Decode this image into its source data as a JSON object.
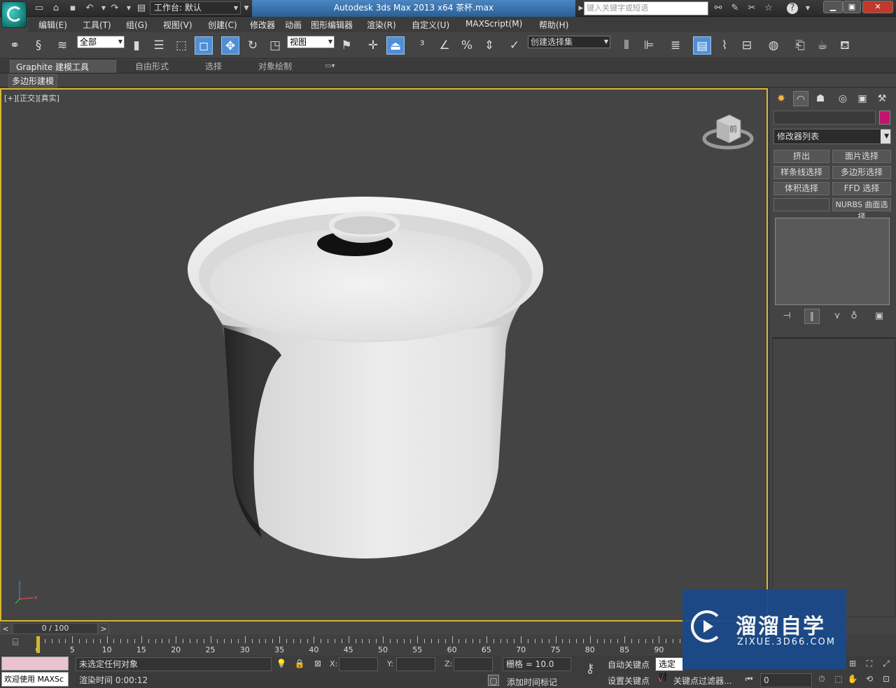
{
  "titlebar": {
    "workspace_label": "工作台: 默认",
    "title": "Autodesk 3ds Max  2013 x64      茶杯.max",
    "search_placeholder": "键入关键字或短语",
    "win_minimize": "▁",
    "win_maximize": "▣",
    "win_close": "✕"
  },
  "menubar": {
    "items": [
      "编辑(E)",
      "工具(T)",
      "组(G)",
      "视图(V)",
      "创建(C)",
      "修改器",
      "动画",
      "图形编辑器",
      "渲染(R)",
      "自定义(U)",
      "MAXScript(M)",
      "帮助(H)"
    ]
  },
  "toolbar": {
    "filter_value": "全部",
    "refcoord_value": "视图",
    "selection_set_value": "创建选择集"
  },
  "ribbon": {
    "tabs": [
      "Graphite 建模工具",
      "自由形式",
      "选择",
      "对象绘制"
    ],
    "sub_panel": "多边形建模"
  },
  "viewport": {
    "label": "[+][正交][真实]",
    "viewcube_label": "前"
  },
  "command_panel": {
    "modifier_list": "修改器列表",
    "buttons": [
      "挤出",
      "面片选择",
      "样条线选择",
      "多边形选择",
      "体积选择",
      "FFD 选择",
      "",
      "NURBS 曲面选择"
    ]
  },
  "timeline": {
    "frame_display": "0 / 100",
    "prev_arrow": "<",
    "next_arrow": ">",
    "tick_labels": [
      "0",
      "5",
      "10",
      "15",
      "20",
      "25",
      "30",
      "35",
      "40",
      "45",
      "50",
      "55",
      "60",
      "65",
      "70",
      "75",
      "80",
      "85",
      "90"
    ]
  },
  "statusbar": {
    "welcome": "欢迎使用 MAXSc",
    "selection_status": "未选定任何对象",
    "render_time": "渲染时间  0:00:12",
    "x_label": "X:",
    "y_label": "Y:",
    "z_label": "Z:",
    "grid": "栅格 = 10.0",
    "add_time_tag": "添加时间标记",
    "auto_key": "自动关键点",
    "set_key": "设置关键点",
    "selected_object": "选定对",
    "key_filters": "关键点过滤器...",
    "current_frame": "0"
  },
  "watermark": {
    "title": "溜溜自学",
    "subtitle": "ZIXUE.3D66.COM"
  },
  "colors": {
    "viewport_border": "#d8b630",
    "title_accent": "#2a5f96",
    "object_color_swatch": "#c2136f",
    "active_tool": "#4f8fd6"
  }
}
